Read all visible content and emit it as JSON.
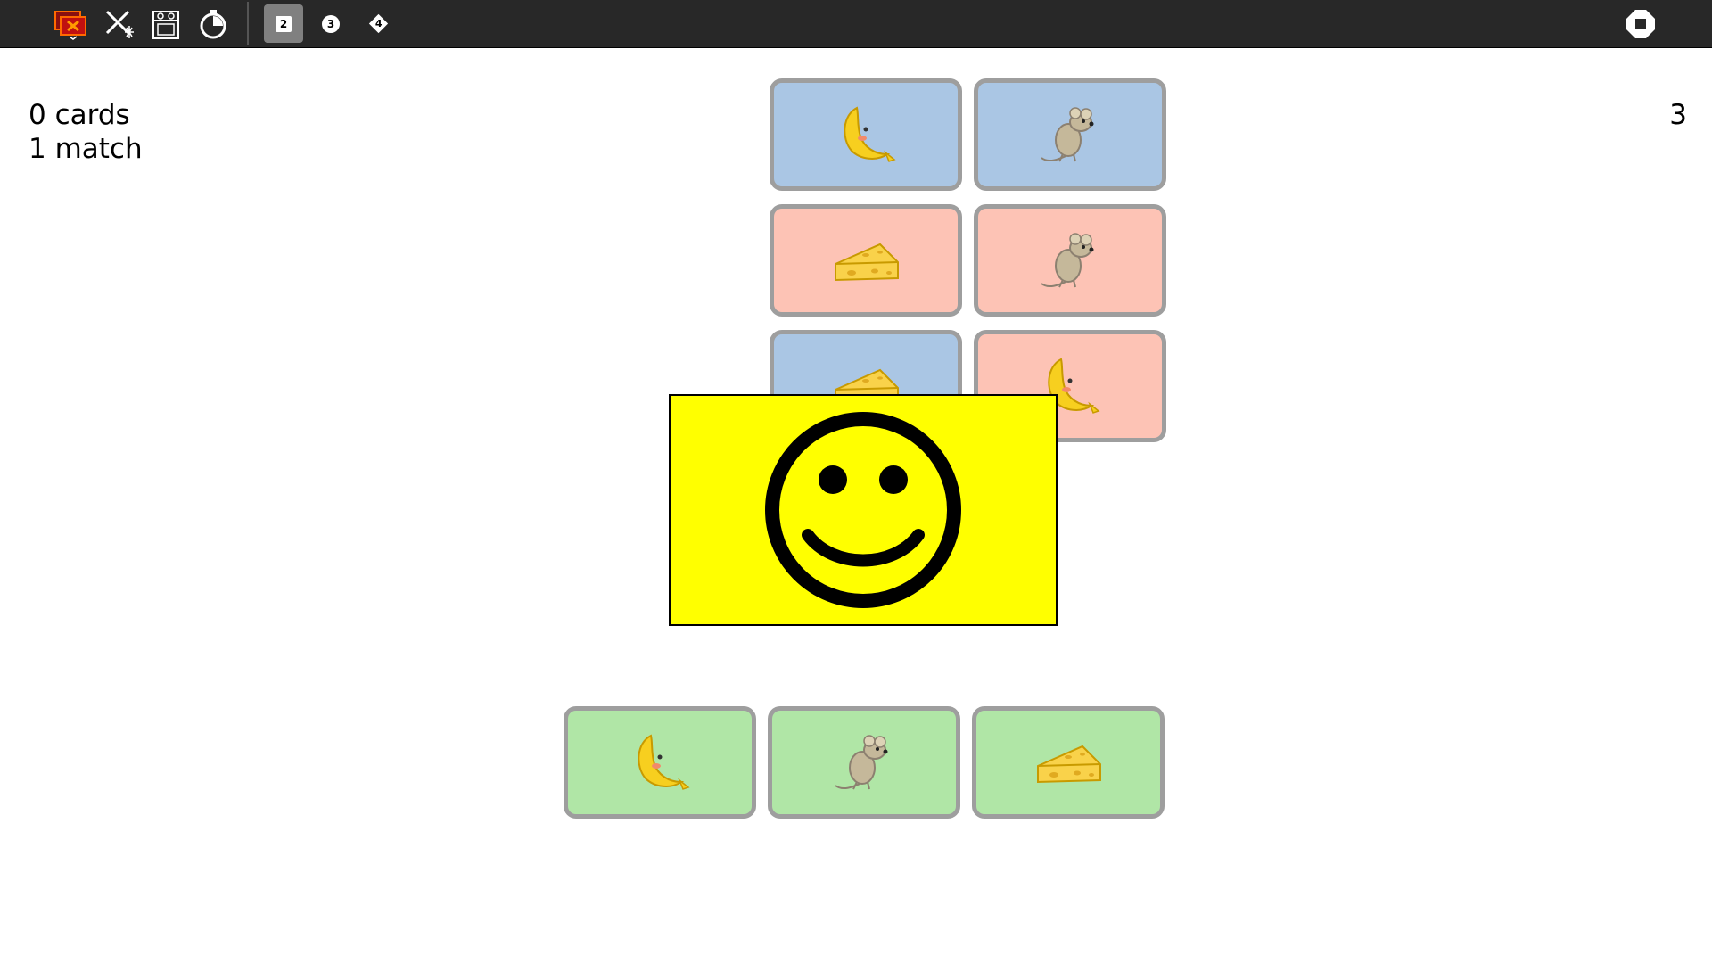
{
  "toolbar": {
    "tools": [
      {
        "name": "activity",
        "icon": "stacked-cards-icon"
      },
      {
        "name": "reset",
        "icon": "crossed-tools-icon"
      },
      {
        "name": "game-mode",
        "icon": "oven-icon"
      },
      {
        "name": "timer",
        "icon": "stopwatch-icon"
      }
    ],
    "levels": [
      {
        "label": "2",
        "active": true
      },
      {
        "label": "3",
        "active": false
      },
      {
        "label": "4",
        "active": false
      }
    ],
    "stop_icon": "stop-icon"
  },
  "score": {
    "cards": "0 cards",
    "matches": "1 match"
  },
  "counter": "3",
  "grid": [
    {
      "color": "blue",
      "picture": "moon"
    },
    {
      "color": "blue",
      "picture": "mouse"
    },
    {
      "color": "pink",
      "picture": "cheese"
    },
    {
      "color": "pink",
      "picture": "mouse"
    },
    {
      "color": "blue",
      "picture": "cheese"
    },
    {
      "color": "pink",
      "picture": "moon"
    }
  ],
  "answers": [
    {
      "color": "green",
      "picture": "moon"
    },
    {
      "color": "green",
      "picture": "mouse"
    },
    {
      "color": "green",
      "picture": "cheese"
    }
  ],
  "feedback": {
    "icon": "smiley-face-icon",
    "background": "#ffff00"
  },
  "colors": {
    "toolbar": "#282828",
    "card_blue": "#aac6e4",
    "card_pink": "#fdc3b5",
    "card_green": "#b0e6a6",
    "card_border": "#9e9e9e"
  }
}
